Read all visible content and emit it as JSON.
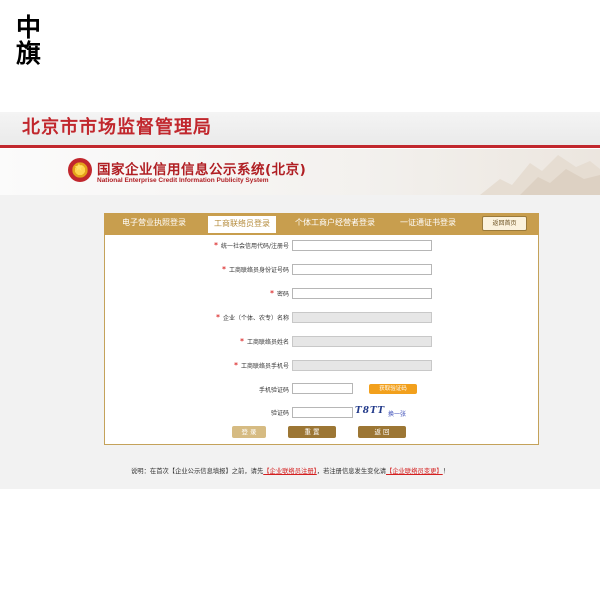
{
  "logo": {
    "line1": "中",
    "line2": "旗"
  },
  "banner": {
    "title": "北京市市场监督管理局"
  },
  "system": {
    "title": "国家企业信用信息公示系统(北京)",
    "subtitle": "National Enterprise Credit Information Publicity System"
  },
  "tabs": [
    "电子营业执照登录",
    "工商联络员登录",
    "个体工商户经营者登录",
    "一证通证书登录"
  ],
  "home_button": "返回首页",
  "form": {
    "uscc_label": "统一社会信用代码/注册号",
    "liaison_id_label": "工商联络员身份证号码",
    "password_label": "密码",
    "company_name_label": "企业（个体、农专）名称",
    "liaison_name_label": "工商联络员姓名",
    "liaison_phone_label": "工商联络员手机号",
    "sms_code_label": "手机验证码",
    "sms_button": "获取验证码",
    "captcha_label": "验证码",
    "captcha_text": "T8TT",
    "captcha_refresh": "换一张"
  },
  "buttons": {
    "login": "登 录",
    "reset": "重 置",
    "back": "返 回"
  },
  "note": {
    "prefix": "说明：在首次【企业公示信息填报】之前，请先",
    "link1": "【企业联络员注册】",
    "middle": "，若注册信息发生变化请",
    "link2": "【企业联络员变更】",
    "suffix": "！"
  },
  "colors": {
    "accent_red": "#c1272d",
    "gold": "#c89e4e",
    "orange": "#f2a01c"
  }
}
